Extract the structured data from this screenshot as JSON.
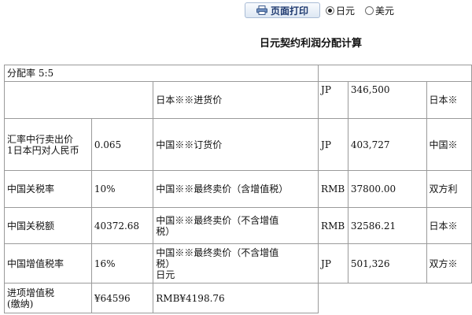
{
  "toolbar": {
    "print_label": "页面打印",
    "currency_options": [
      {
        "label": "日元",
        "selected": true
      },
      {
        "label": "美元",
        "selected": false
      }
    ]
  },
  "page_title": "日元契约利润分配计算",
  "table": {
    "ratio_row": "分配率  5:5",
    "rows": [
      {
        "c1": "",
        "c2": "",
        "c3": "日本※※进货价",
        "c4": "JP",
        "c5": "346,500",
        "c6": "日本※"
      },
      {
        "c1_line1": "汇率中行卖出价",
        "c1_line2": "1日本円对人民币",
        "c2": "0.065",
        "c3": "中国※※订货价",
        "c4": "JP",
        "c5": "403,727",
        "c6": "中国※"
      },
      {
        "c1": "中国关税率",
        "c2": "10%",
        "c3": "中国※※最终卖价（含增值税）",
        "c4": "RMB",
        "c5": "37800.00",
        "c6": "双方利"
      },
      {
        "c1": "中国关税额",
        "c2": "40372.68",
        "c3_line1": "中国※※最终卖价（不含增值",
        "c3_line2": "税）",
        "c4": "RMB",
        "c5": "32586.21",
        "c6": "日本※"
      },
      {
        "c1": "中国增值税率",
        "c2": "16%",
        "c3_line1": "中国※※最终卖价（不含增值",
        "c3_line2": "税）",
        "c3_line3": "日元",
        "c4": "JP",
        "c5": "501,326",
        "c6": "双方※"
      },
      {
        "c1_line1": "进项增值税",
        "c1_line2": "(缴纳)",
        "c2": "¥64596",
        "c3": "RMB¥4198.76"
      }
    ]
  }
}
